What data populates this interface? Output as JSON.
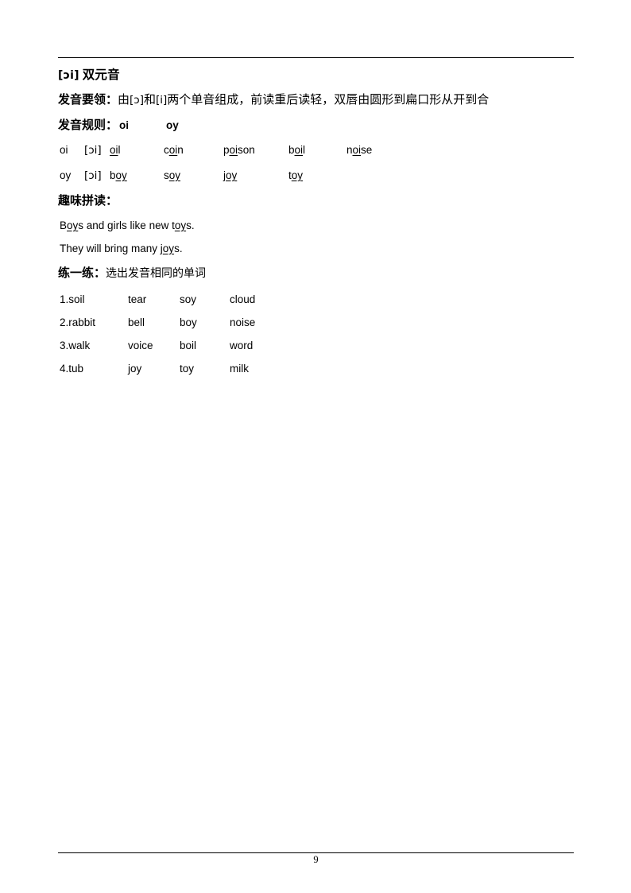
{
  "document": {
    "page_number": "9",
    "title": {
      "ipa": "[ɔi]",
      "cn": "双元音"
    },
    "key_points": {
      "label": "发音要领：",
      "part1": "由",
      "ipa1": "[ɔ]",
      "part2": "和",
      "ipa2": "[i]",
      "part3": "两个单音组成，前读重后读轻，双唇由圆形到扁口形从开到合"
    },
    "rules": {
      "label": "发音规则：",
      "group1": "oi",
      "group2": "oy"
    },
    "word_rows": [
      {
        "key": "oi",
        "ipa": "[ɔi]",
        "words": [
          {
            "pre": "",
            "mid": "oi",
            "post": "l"
          },
          {
            "pre": "c",
            "mid": "oi",
            "post": "n"
          },
          {
            "pre": "p",
            "mid": "oi",
            "post": "son"
          },
          {
            "pre": "b",
            "mid": "oi",
            "post": "l"
          },
          {
            "pre": "n",
            "mid": "oi",
            "post": "se"
          }
        ]
      },
      {
        "key": "oy",
        "ipa": "[ɔi]",
        "words": [
          {
            "pre": "b",
            "mid": "oy",
            "post": ""
          },
          {
            "pre": "s",
            "mid": "oy",
            "post": ""
          },
          {
            "pre": "j",
            "mid": "oy",
            "post": ""
          },
          {
            "pre": "t",
            "mid": "oy",
            "post": ""
          }
        ]
      }
    ],
    "fun_reading": {
      "heading": "趣味拼读：",
      "sentences": [
        {
          "p1": "B",
          "u1": "oy",
          "p2": "s and girls like new t",
          "u2": "oy",
          "p3": "s."
        },
        {
          "p1": "They will bring many j",
          "u1": "oy",
          "p2": "",
          "u2": "",
          "p3": "s."
        }
      ]
    },
    "practice": {
      "label": "练一练：",
      "instruction": "选出发音相同的单词",
      "rows": [
        [
          "1.soil",
          "tear",
          "soy",
          "cloud"
        ],
        [
          "2.rabbit",
          "bell",
          "boy",
          "noise"
        ],
        [
          "3.walk",
          "voice",
          "boil",
          "word"
        ],
        [
          "4.tub",
          "joy",
          "toy",
          "milk"
        ]
      ]
    }
  }
}
